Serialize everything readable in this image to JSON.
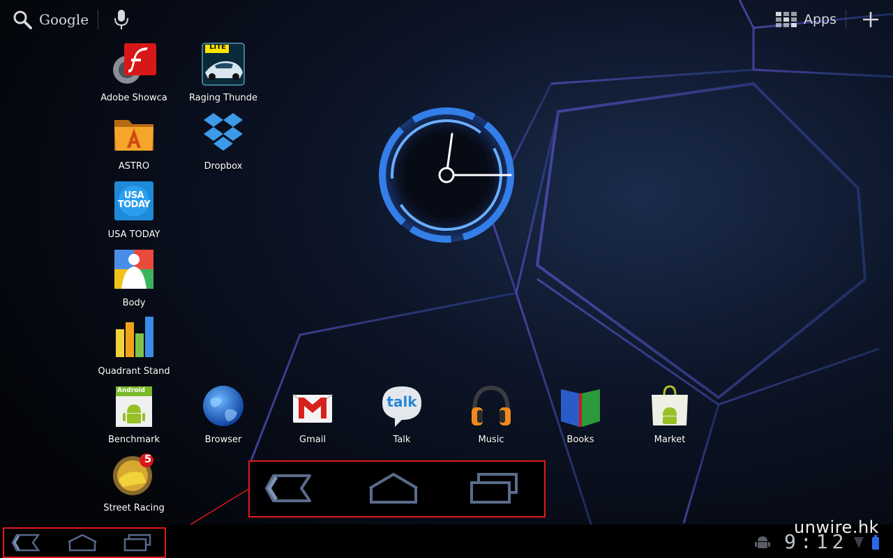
{
  "topbar": {
    "search_label": "Google",
    "apps_label": "Apps"
  },
  "apps": [
    {
      "label": "Adobe Showca",
      "icon": "flash-icon"
    },
    {
      "label": "Raging Thunde",
      "icon": "race-car-icon"
    },
    {
      "label": "ASTRO",
      "icon": "astro-folder-icon"
    },
    {
      "label": "Dropbox",
      "icon": "dropbox-icon"
    },
    {
      "label": "USA TODAY",
      "icon": "usa-today-icon"
    },
    {
      "label": "Body",
      "icon": "body-icon"
    },
    {
      "label": "Quadrant Stand",
      "icon": "bar-chart-icon"
    },
    {
      "label": "Benchmark",
      "icon": "android-benchmark-icon"
    },
    {
      "label": "Browser",
      "icon": "globe-icon"
    },
    {
      "label": "Gmail",
      "icon": "gmail-icon"
    },
    {
      "label": "Talk",
      "icon": "talk-bubble-icon"
    },
    {
      "label": "Music",
      "icon": "headphones-icon"
    },
    {
      "label": "Books",
      "icon": "book-icon"
    },
    {
      "label": "Market",
      "icon": "market-bag-icon"
    },
    {
      "label": "Street Racing",
      "icon": "street-racing-icon"
    }
  ],
  "usa_today_text": "USA TODAY",
  "benchmark_badge": "Android",
  "street_racing_badge": "5",
  "talk_icon_text": "talk",
  "raging_badge": "LITE",
  "statusbar": {
    "time": "9:12",
    "watermark": "unwire.hk"
  },
  "colors": {
    "accent_blue": "#3a8cff",
    "highlight_red": "#e01a1a"
  }
}
